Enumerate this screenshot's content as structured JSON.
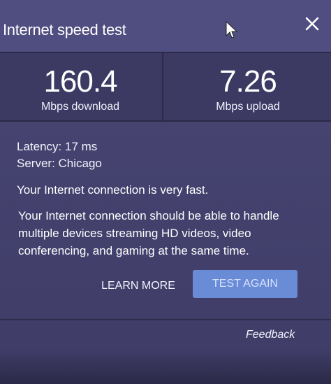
{
  "dialog": {
    "title": "Internet speed test",
    "close_icon": "close-icon",
    "cursor_icon": "pointer-cursor-icon"
  },
  "results": {
    "download": {
      "value": "160.4",
      "label": "Mbps download"
    },
    "upload": {
      "value": "7.26",
      "label": "Mbps upload"
    }
  },
  "details": {
    "latency": "Latency: 17 ms",
    "server": "Server: Chicago"
  },
  "message": {
    "headline": "Your Internet connection is very fast.",
    "body": "Your Internet connection should be able to handle multiple devices streaming HD videos, video conferencing, and gaming at the same time."
  },
  "actions": {
    "learn_more": "LEARN MORE",
    "test_again": "TEST AGAIN"
  },
  "footer": {
    "feedback": "Feedback"
  },
  "colors": {
    "panel": "#4b4877",
    "header": "#504d80",
    "stats_bg": "#3c3a63",
    "test_button": "#6a8bd6"
  }
}
